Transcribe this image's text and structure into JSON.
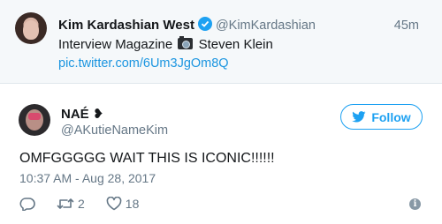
{
  "quoted_tweet": {
    "name": "Kim Kardashian West",
    "handle": "@KimKardashian",
    "time": "45m",
    "text_before": "Interview Magazine",
    "text_after": "Steven Klein",
    "link": "pic.twitter.com/6Um3JgOm8Q"
  },
  "tweet": {
    "author_name": "NAÉ",
    "author_emoji": "❥",
    "author_handle": "@AKutieNameKim",
    "follow_label": "Follow",
    "text": "OMFGGGGG WAIT THIS IS ICONIC!!!!!!",
    "timestamp": "10:37 AM - Aug 28, 2017",
    "retweet_count": "2",
    "like_count": "18"
  },
  "colors": {
    "accent": "#1da1f2",
    "link": "#1b95e0",
    "muted": "#657786",
    "quoted_bg": "#f5f8fa"
  },
  "icons": [
    "verified-badge-icon",
    "camera-emoji-icon",
    "twitter-bird-icon",
    "reply-icon",
    "retweet-icon",
    "like-heart-icon",
    "info-icon"
  ]
}
